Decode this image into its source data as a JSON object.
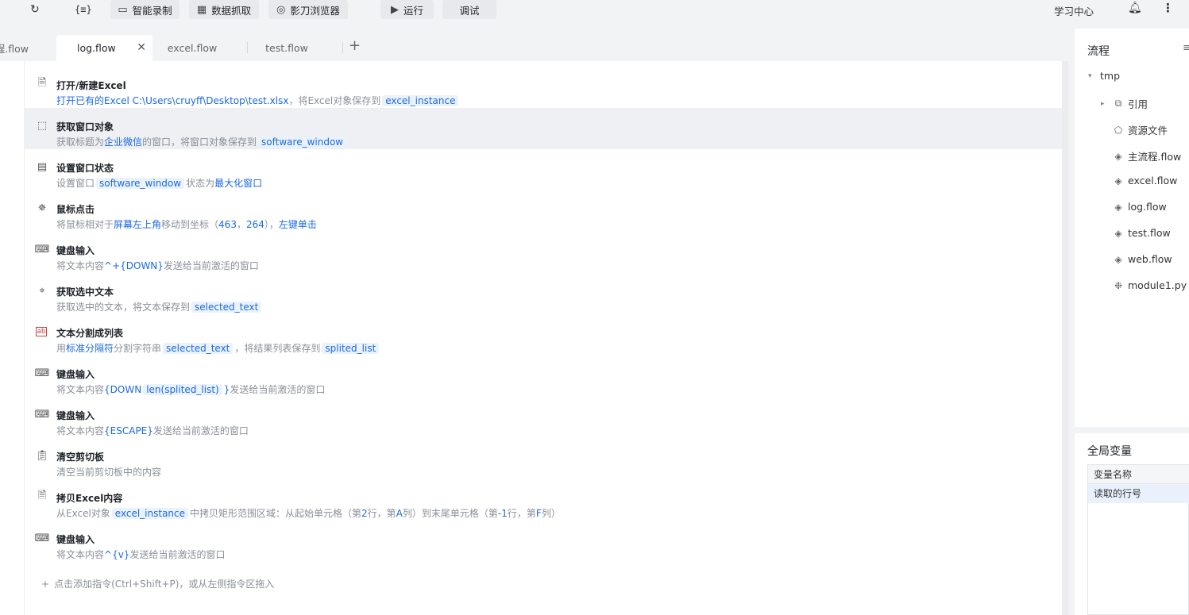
{
  "toolbar": {
    "redo_icon": "redo-icon",
    "braces_icon": "variable-braces-icon",
    "smart_record": "智能录制",
    "data_capture": "数据抓取",
    "browser": "影刀浏览器",
    "run": "运行",
    "debug": "调试",
    "learning_center": "学习中心"
  },
  "tabs": [
    {
      "label": "程.flow"
    },
    {
      "label": "log.flow",
      "active": true
    },
    {
      "label": "excel.flow"
    },
    {
      "label": "test.flow"
    }
  ],
  "steps": [
    {
      "icon": "excel-open-icon",
      "title": "打开/新建Excel",
      "desc_a": "打开已有的Excel C:\\Users\\cruyff\\Desktop\\test.xlsx",
      "desc_b": "，将Excel对象保存到",
      "chip": "excel_instance"
    },
    {
      "icon": "window-object-icon",
      "title": "获取窗口对象",
      "desc_a": "获取标题为",
      "hl1": "企业微信",
      "desc_b": "的窗口，将窗口对象保存到",
      "chip": "software_window"
    },
    {
      "icon": "window-state-icon",
      "title": "设置窗口状态",
      "desc_a": "设置窗口",
      "chip": "software_window",
      "desc_b": "状态为",
      "hl1": "最大化窗口"
    },
    {
      "icon": "mouse-click-icon",
      "title": "鼠标点击",
      "desc_a": "将鼠标相对于",
      "hl1": "屏幕左上角",
      "desc_b": "移动到坐标（",
      "hl2": "463",
      "desc_c": "，",
      "hl3": "264",
      "desc_d": "），",
      "hl4": "左键单击"
    },
    {
      "icon": "keyboard-icon",
      "title": "键盘输入",
      "desc_a": "将文本内容",
      "hl1": "^+{DOWN}",
      "desc_b": "发送给当前激活的窗口"
    },
    {
      "icon": "select-text-icon",
      "title": "获取选中文本",
      "desc_a": "获取选中的文本，将文本保存到",
      "chip": "selected_text"
    },
    {
      "icon": "split-text-icon",
      "title": "文本分割成列表",
      "desc_a": "用",
      "hl1": "标准分隔符",
      "desc_b": "分割字符串",
      "chip": "selected_text",
      "desc_c": "，将结果列表保存到",
      "chip2": "splited_list"
    },
    {
      "icon": "keyboard-icon",
      "title": "键盘输入",
      "desc_a": "将文本内容",
      "hl1": "{DOWN",
      "chip": "len(splited_list)",
      "hl2": "}",
      "desc_b": "发送给当前激活的窗口"
    },
    {
      "icon": "keyboard-icon",
      "title": "键盘输入",
      "desc_a": "将文本内容",
      "hl1": "{ESCAPE}",
      "desc_b": "发送给当前激活的窗口"
    },
    {
      "icon": "clipboard-icon",
      "title": "清空剪切板",
      "desc_a": "清空当前剪切板中的内容"
    },
    {
      "icon": "excel-copy-icon",
      "title": "拷贝Excel内容",
      "desc_a": "从Excel对象",
      "chip": "excel_instance",
      "desc_b": "中拷贝矩形范围区域：从起始单元格（第",
      "hl1": "2",
      "desc_c": "行，第",
      "hl2": "A",
      "desc_d": "列）到末尾单元格（第",
      "hl3": "-1",
      "desc_e": "行，第",
      "hl4": "F",
      "desc_f": "列）"
    },
    {
      "icon": "keyboard-icon",
      "title": "键盘输入",
      "desc_a": "将文本内容",
      "hl1": "^{v}",
      "desc_b": "发送给当前激活的窗口"
    }
  ],
  "add_hint": "点击添加指令(Ctrl+Shift+P)，或从左侧指令区拖入",
  "right_panel": {
    "title": "流程",
    "tree": [
      {
        "label": "tmp",
        "icon": "caret-down-icon"
      },
      {
        "label": "引用",
        "icon": "reference-icon"
      },
      {
        "label": "资源文件",
        "icon": "resource-file-icon"
      },
      {
        "label": "主流程.flow",
        "icon": "flow-layers-icon"
      },
      {
        "label": "excel.flow",
        "icon": "flow-layers-icon"
      },
      {
        "label": "log.flow",
        "icon": "flow-layers-icon"
      },
      {
        "label": "test.flow",
        "icon": "flow-layers-icon"
      },
      {
        "label": "web.flow",
        "icon": "flow-layers-icon"
      },
      {
        "label": "module1.py",
        "icon": "python-icon"
      }
    ],
    "globals_title": "全局变量",
    "globals_header": "变量名称",
    "globals_rows": [
      "读取的行号"
    ]
  },
  "colors": {
    "accent": "#1b6ae0",
    "chip_bg": "#eaf2fd",
    "selected_row": "#eef0f3"
  }
}
